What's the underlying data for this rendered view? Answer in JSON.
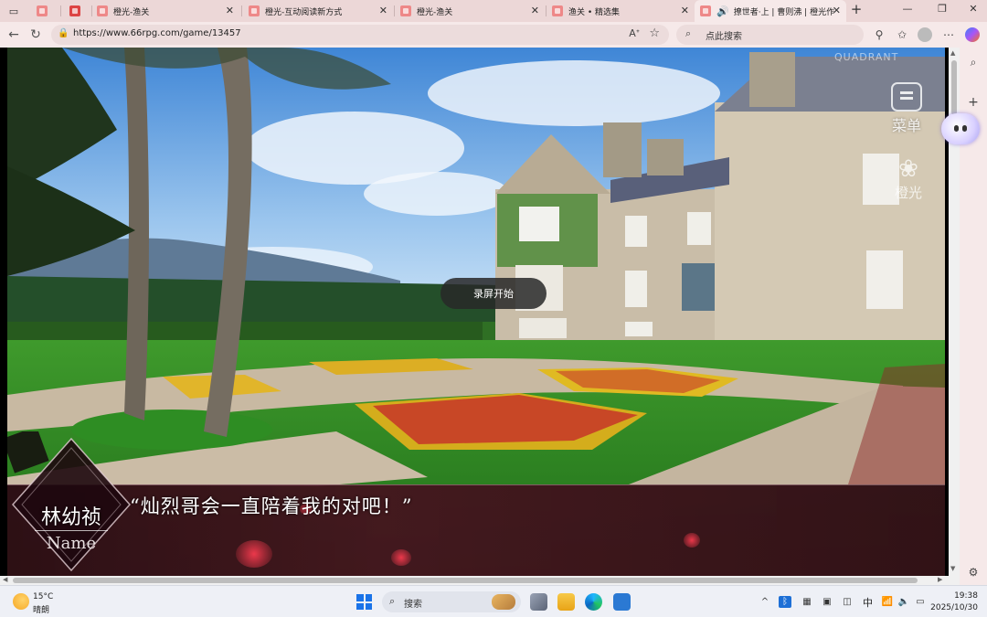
{
  "browser": {
    "tabs": [
      {
        "title": ""
      },
      {
        "title": ""
      },
      {
        "title": "橙光-渔关"
      },
      {
        "title": "橙光-互动阅读新方式"
      },
      {
        "title": "橙光-渔关"
      },
      {
        "title": "渔关 • 精选集"
      },
      {
        "title": "撩世者·上 | 曹则沸 | 橙光作"
      }
    ],
    "url": "https://www.66rpg.com/game/13457",
    "search_placeholder": "点此搜索",
    "new_tab_symbol": "+"
  },
  "game": {
    "record_toast": "录屏开始",
    "menu_label": "菜单",
    "brand_label": "橙光",
    "watermark": "QUADRANT",
    "dialog": {
      "speaker": "林幼祯",
      "speaker_sub": "Name",
      "line": "“灿烈哥会一直陪着我的对吧！”"
    }
  },
  "taskbar": {
    "weather_temp": "15°C",
    "weather_desc": "晴朗",
    "search_placeholder": "搜索",
    "ime": "中",
    "time": "19:38",
    "date": "2025/10/30"
  },
  "colors": {
    "chrome_bg": "#f6e9e9",
    "tabstrip_bg": "#ecd7d7",
    "dialog_bg": "#3a0d1a",
    "taskbar_bg": "#eef0f6"
  }
}
